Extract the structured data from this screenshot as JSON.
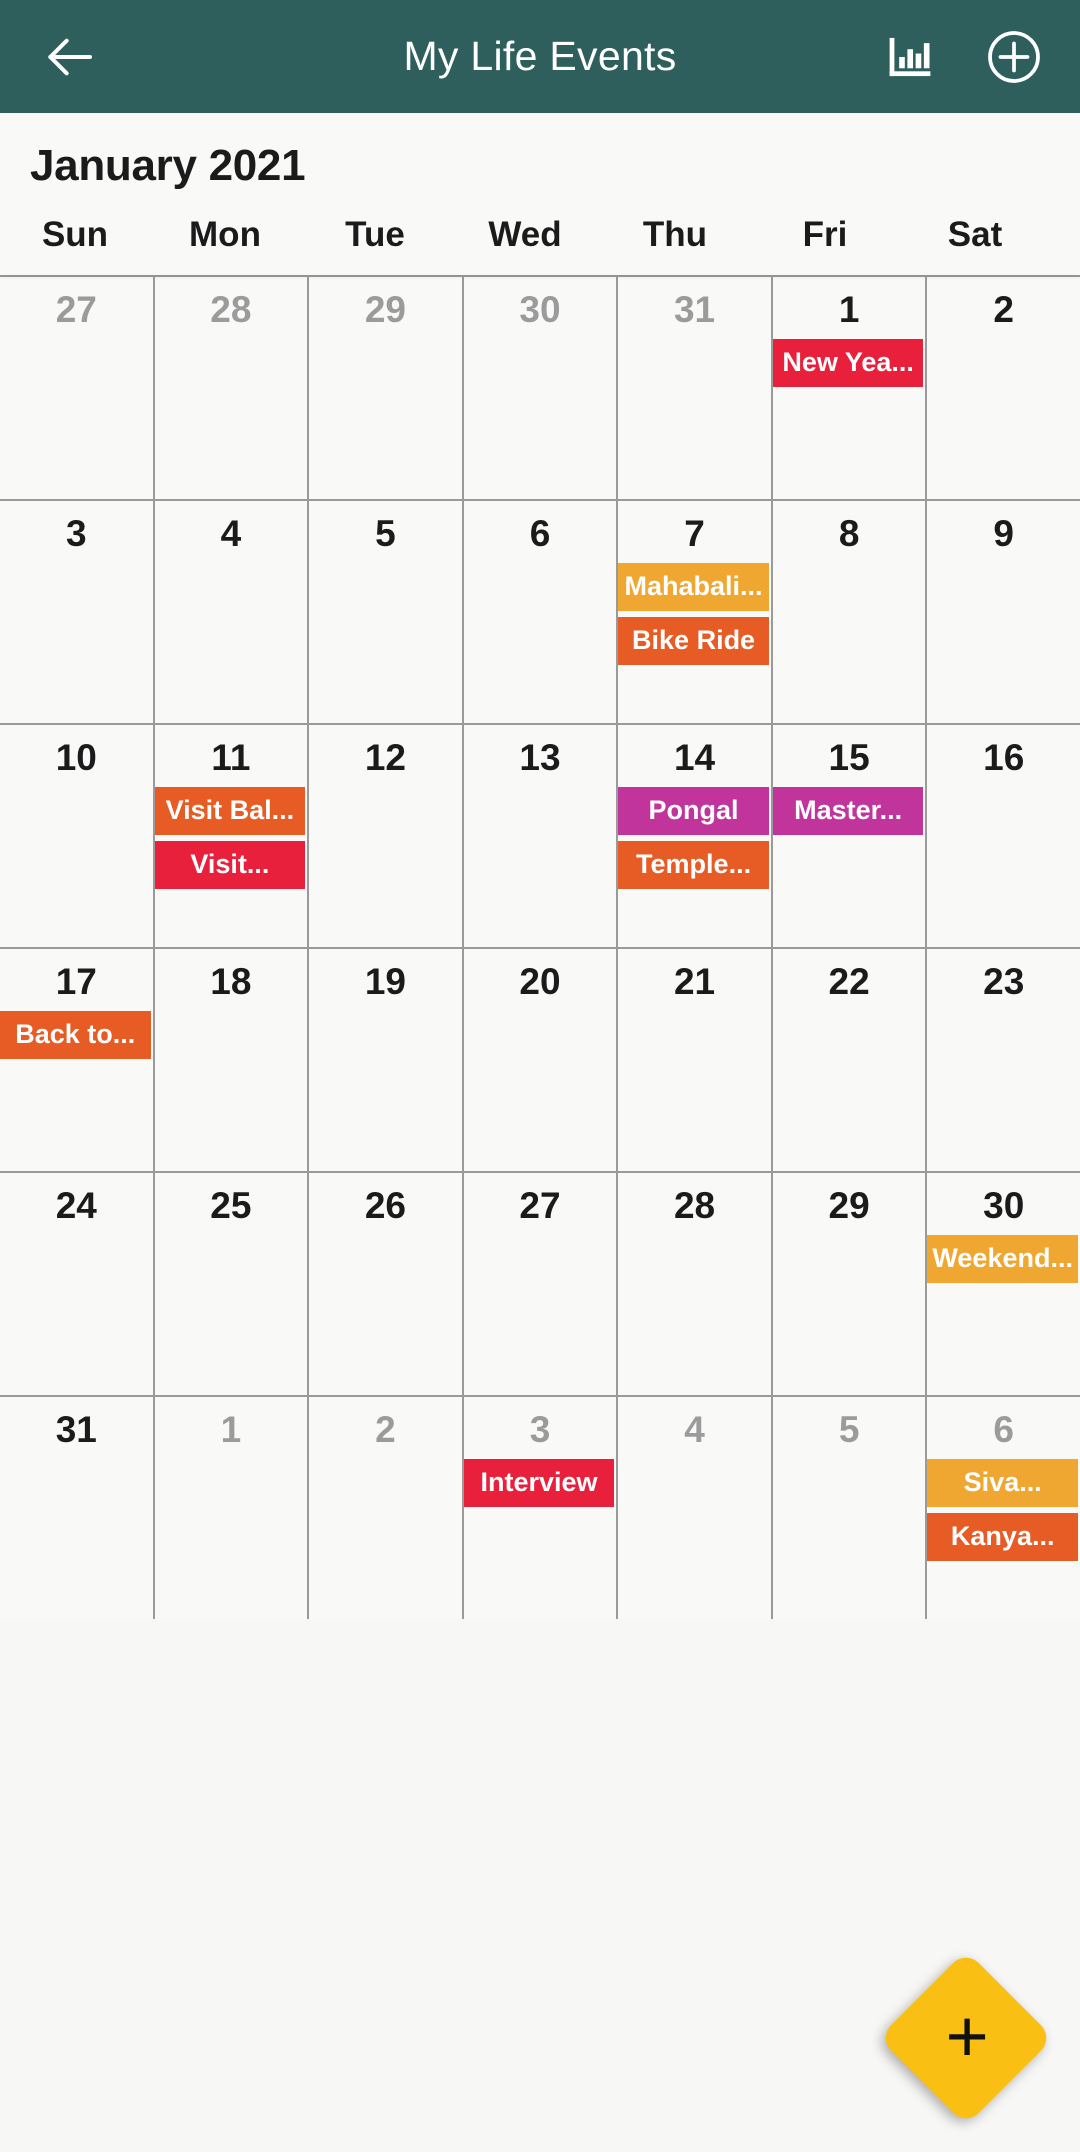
{
  "appbar": {
    "title": "My Life Events",
    "back_icon": "back-arrow-icon",
    "stats_icon": "bar-chart-icon",
    "add_icon": "plus-circle-icon",
    "background_color": "#2e5f5c"
  },
  "month": {
    "title": "January 2021"
  },
  "weekdays": [
    "Sun",
    "Mon",
    "Tue",
    "Wed",
    "Thu",
    "Fri",
    "Sat"
  ],
  "fab": {
    "label": "+",
    "name": "add-event-fab",
    "color": "#f9c013"
  },
  "event_colors": {
    "red": "#e8203c",
    "amber": "#f0a731",
    "orange": "#e75b24",
    "magenta": "#c0349b"
  },
  "days": [
    {
      "num": "27",
      "other": true,
      "events": []
    },
    {
      "num": "28",
      "other": true,
      "events": []
    },
    {
      "num": "29",
      "other": true,
      "events": []
    },
    {
      "num": "30",
      "other": true,
      "events": []
    },
    {
      "num": "31",
      "other": true,
      "events": []
    },
    {
      "num": "1",
      "other": false,
      "events": [
        {
          "label": "New Yea...",
          "color": "#e8203c"
        }
      ]
    },
    {
      "num": "2",
      "other": false,
      "events": []
    },
    {
      "num": "3",
      "other": false,
      "events": []
    },
    {
      "num": "4",
      "other": false,
      "events": []
    },
    {
      "num": "5",
      "other": false,
      "events": []
    },
    {
      "num": "6",
      "other": false,
      "events": []
    },
    {
      "num": "7",
      "other": false,
      "events": [
        {
          "label": "Mahabali...",
          "color": "#f0a731"
        },
        {
          "label": "Bike Ride",
          "color": "#e75b24"
        }
      ]
    },
    {
      "num": "8",
      "other": false,
      "events": []
    },
    {
      "num": "9",
      "other": false,
      "events": []
    },
    {
      "num": "10",
      "other": false,
      "events": []
    },
    {
      "num": "11",
      "other": false,
      "events": [
        {
          "label": "Visit Bal...",
          "color": "#e75b24"
        },
        {
          "label": "Visit...",
          "color": "#e8203c"
        }
      ]
    },
    {
      "num": "12",
      "other": false,
      "events": []
    },
    {
      "num": "13",
      "other": false,
      "events": []
    },
    {
      "num": "14",
      "other": false,
      "events": [
        {
          "label": "Pongal",
          "color": "#c0349b"
        },
        {
          "label": "Temple...",
          "color": "#e75b24"
        }
      ]
    },
    {
      "num": "15",
      "other": false,
      "events": [
        {
          "label": "Master...",
          "color": "#c0349b"
        }
      ]
    },
    {
      "num": "16",
      "other": false,
      "events": []
    },
    {
      "num": "17",
      "other": false,
      "events": [
        {
          "label": "Back to...",
          "color": "#e75b24"
        }
      ]
    },
    {
      "num": "18",
      "other": false,
      "events": []
    },
    {
      "num": "19",
      "other": false,
      "events": []
    },
    {
      "num": "20",
      "other": false,
      "events": []
    },
    {
      "num": "21",
      "other": false,
      "events": []
    },
    {
      "num": "22",
      "other": false,
      "events": []
    },
    {
      "num": "23",
      "other": false,
      "events": []
    },
    {
      "num": "24",
      "other": false,
      "events": []
    },
    {
      "num": "25",
      "other": false,
      "events": []
    },
    {
      "num": "26",
      "other": false,
      "events": []
    },
    {
      "num": "27",
      "other": false,
      "events": []
    },
    {
      "num": "28",
      "other": false,
      "events": []
    },
    {
      "num": "29",
      "other": false,
      "events": []
    },
    {
      "num": "30",
      "other": false,
      "events": [
        {
          "label": "Weekend...",
          "color": "#f0a731"
        }
      ]
    },
    {
      "num": "31",
      "other": false,
      "events": []
    },
    {
      "num": "1",
      "other": true,
      "events": []
    },
    {
      "num": "2",
      "other": true,
      "events": []
    },
    {
      "num": "3",
      "other": true,
      "events": [
        {
          "label": "Interview",
          "color": "#e8203c"
        }
      ]
    },
    {
      "num": "4",
      "other": true,
      "events": []
    },
    {
      "num": "5",
      "other": true,
      "events": []
    },
    {
      "num": "6",
      "other": true,
      "events": [
        {
          "label": "Siva...",
          "color": "#f0a731"
        },
        {
          "label": "Kanya...",
          "color": "#e75b24"
        }
      ]
    }
  ]
}
